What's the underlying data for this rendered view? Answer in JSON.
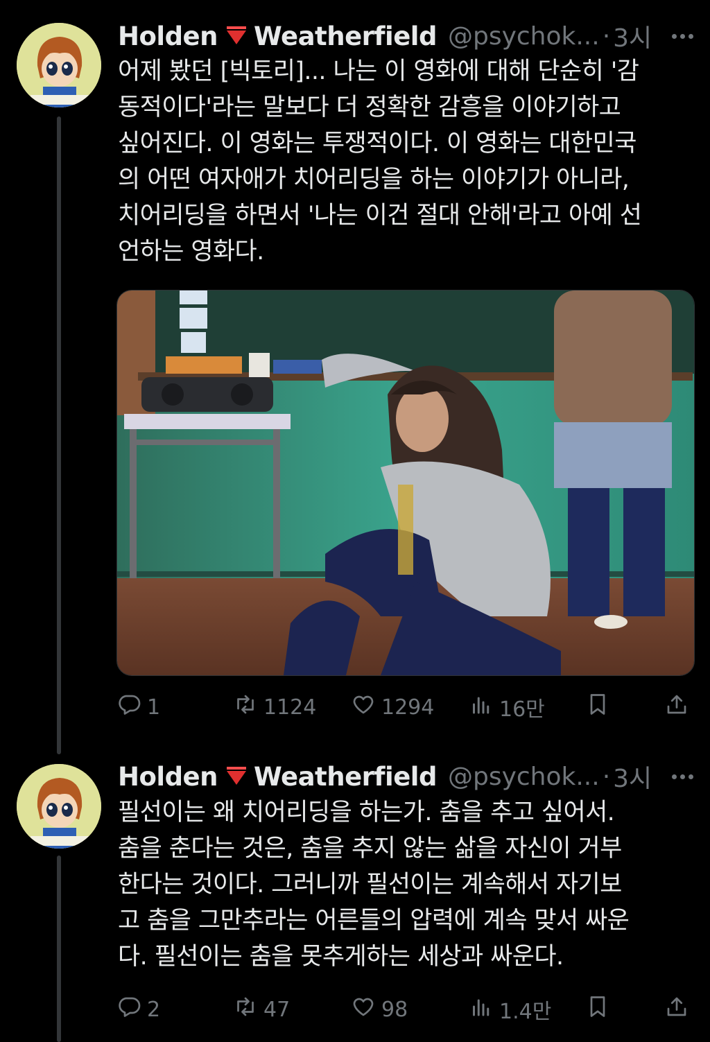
{
  "tweets": [
    {
      "display_name_first": "Holden",
      "display_name_last": "Weatherfield",
      "handle": "@psychok...",
      "separator": "·",
      "time": "3시",
      "text_lines": [
        "어제 봤던 [빅토리]... 나는 이 영화에 대해 단순히 '감",
        "동적이다'라는 말보다 더 정확한 감흥을 이야기하고",
        "싶어진다. 이 영화는 투쟁적이다. 이 영화는 대한민국",
        "의 어떤 여자애가 치어리딩을 하는 이야기가 아니라,",
        "치어리딩을 하면서 '나는 이건 절대 안해'라고 아예 선",
        "언하는 영화다."
      ],
      "has_media": true,
      "stats": {
        "replies": "1",
        "retweets": "1124",
        "likes": "1294",
        "views": "16만"
      }
    },
    {
      "display_name_first": "Holden",
      "display_name_last": "Weatherfield",
      "handle": "@psychok...",
      "separator": "·",
      "time": "3시",
      "text_lines": [
        "필선이는 왜 치어리딩을 하는가. 춤을 추고 싶어서.",
        "춤을 춘다는 것은, 춤을 추지 않는 삶을 자신이 거부",
        "한다는 것이다. 그러니까 필선이는 계속해서 자기보",
        "고 춤을 그만추라는 어른들의 압력에 계속 맞서 싸운",
        "다. 필선이는 춤을 못추게하는 세상과 싸운다."
      ],
      "has_media": false,
      "stats": {
        "replies": "2",
        "retweets": "47",
        "likes": "98",
        "views": "1.4만"
      }
    }
  ],
  "icons": {
    "flag": "red-triangle-flag-icon",
    "more": "more-dots-icon",
    "reply": "reply-icon",
    "retweet": "retweet-icon",
    "like": "heart-icon",
    "views": "views-chart-icon",
    "bookmark": "bookmark-icon",
    "share": "share-icon"
  },
  "colors": {
    "background": "#000000",
    "text": "#e7e9ea",
    "muted": "#71767b",
    "flag_red": "#e0302f",
    "avatar_bg": "#dfe29a"
  }
}
